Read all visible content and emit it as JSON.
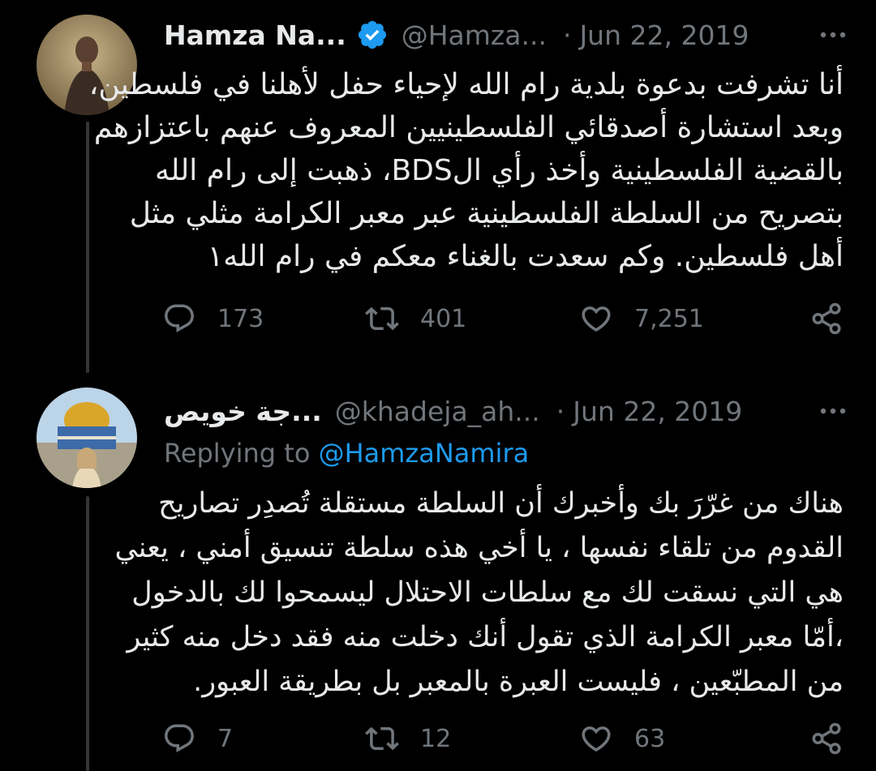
{
  "tweets": [
    {
      "display_name": "Hamza Na...",
      "handle": "@Hamza...",
      "separator": "·",
      "date": "Jun 22, 2019",
      "verified": true,
      "body_lines": [
        "أنا تشرفت بدعوة بلدية رام الله لإحياء حفل لأهلنا في فلسطين،",
        "وبعد استشارة أصدقائي الفلسطينيين المعروف عنهم باعتزازهم",
        "بالقضية الفلسطينية وأخذ رأي الBDS، ذهبت إلى رام الله",
        "بتصريح من السلطة الفلسطينية عبر معبر الكرامة مثلي مثل",
        "أهل فلسطين. وكم سعدت بالغناء معكم في رام الله١"
      ],
      "replies": "173",
      "retweets": "401",
      "likes": "7,251"
    },
    {
      "display_name": "...جة خويص",
      "handle": "@khadeja_ah...",
      "separator": "·",
      "date": "Jun 22, 2019",
      "verified": false,
      "replying_label": "Replying to",
      "replying_mention": "@HamzaNamira",
      "body_lines": [
        "هناك من غرّرَ بك وأخبرك أن السلطة مستقلة تُصدِر تصاريح",
        "القدوم من تلقاء نفسها ، يا أخي هذه سلطة تنسيق أمني ، يعني",
        "هي التي نسقت لك مع سلطات الاحتلال ليسمحوا لك بالدخول",
        "،أمّا معبر الكرامة الذي تقول أنك دخلت منه فقد دخل منه كثير",
        "من المطبّعين ، فليست العبرة بالمعبر بل بطريقة العبور."
      ],
      "replies": "7",
      "retweets": "12",
      "likes": "63"
    }
  ],
  "colors": {
    "background": "#000000",
    "text_primary": "#e7e9ea",
    "text_secondary": "#71767b",
    "accent": "#1d9bf0",
    "thread_line": "#333639"
  },
  "icons": [
    "verified-badge-icon",
    "more-icon",
    "reply-icon",
    "retweet-icon",
    "like-icon",
    "share-icon"
  ]
}
